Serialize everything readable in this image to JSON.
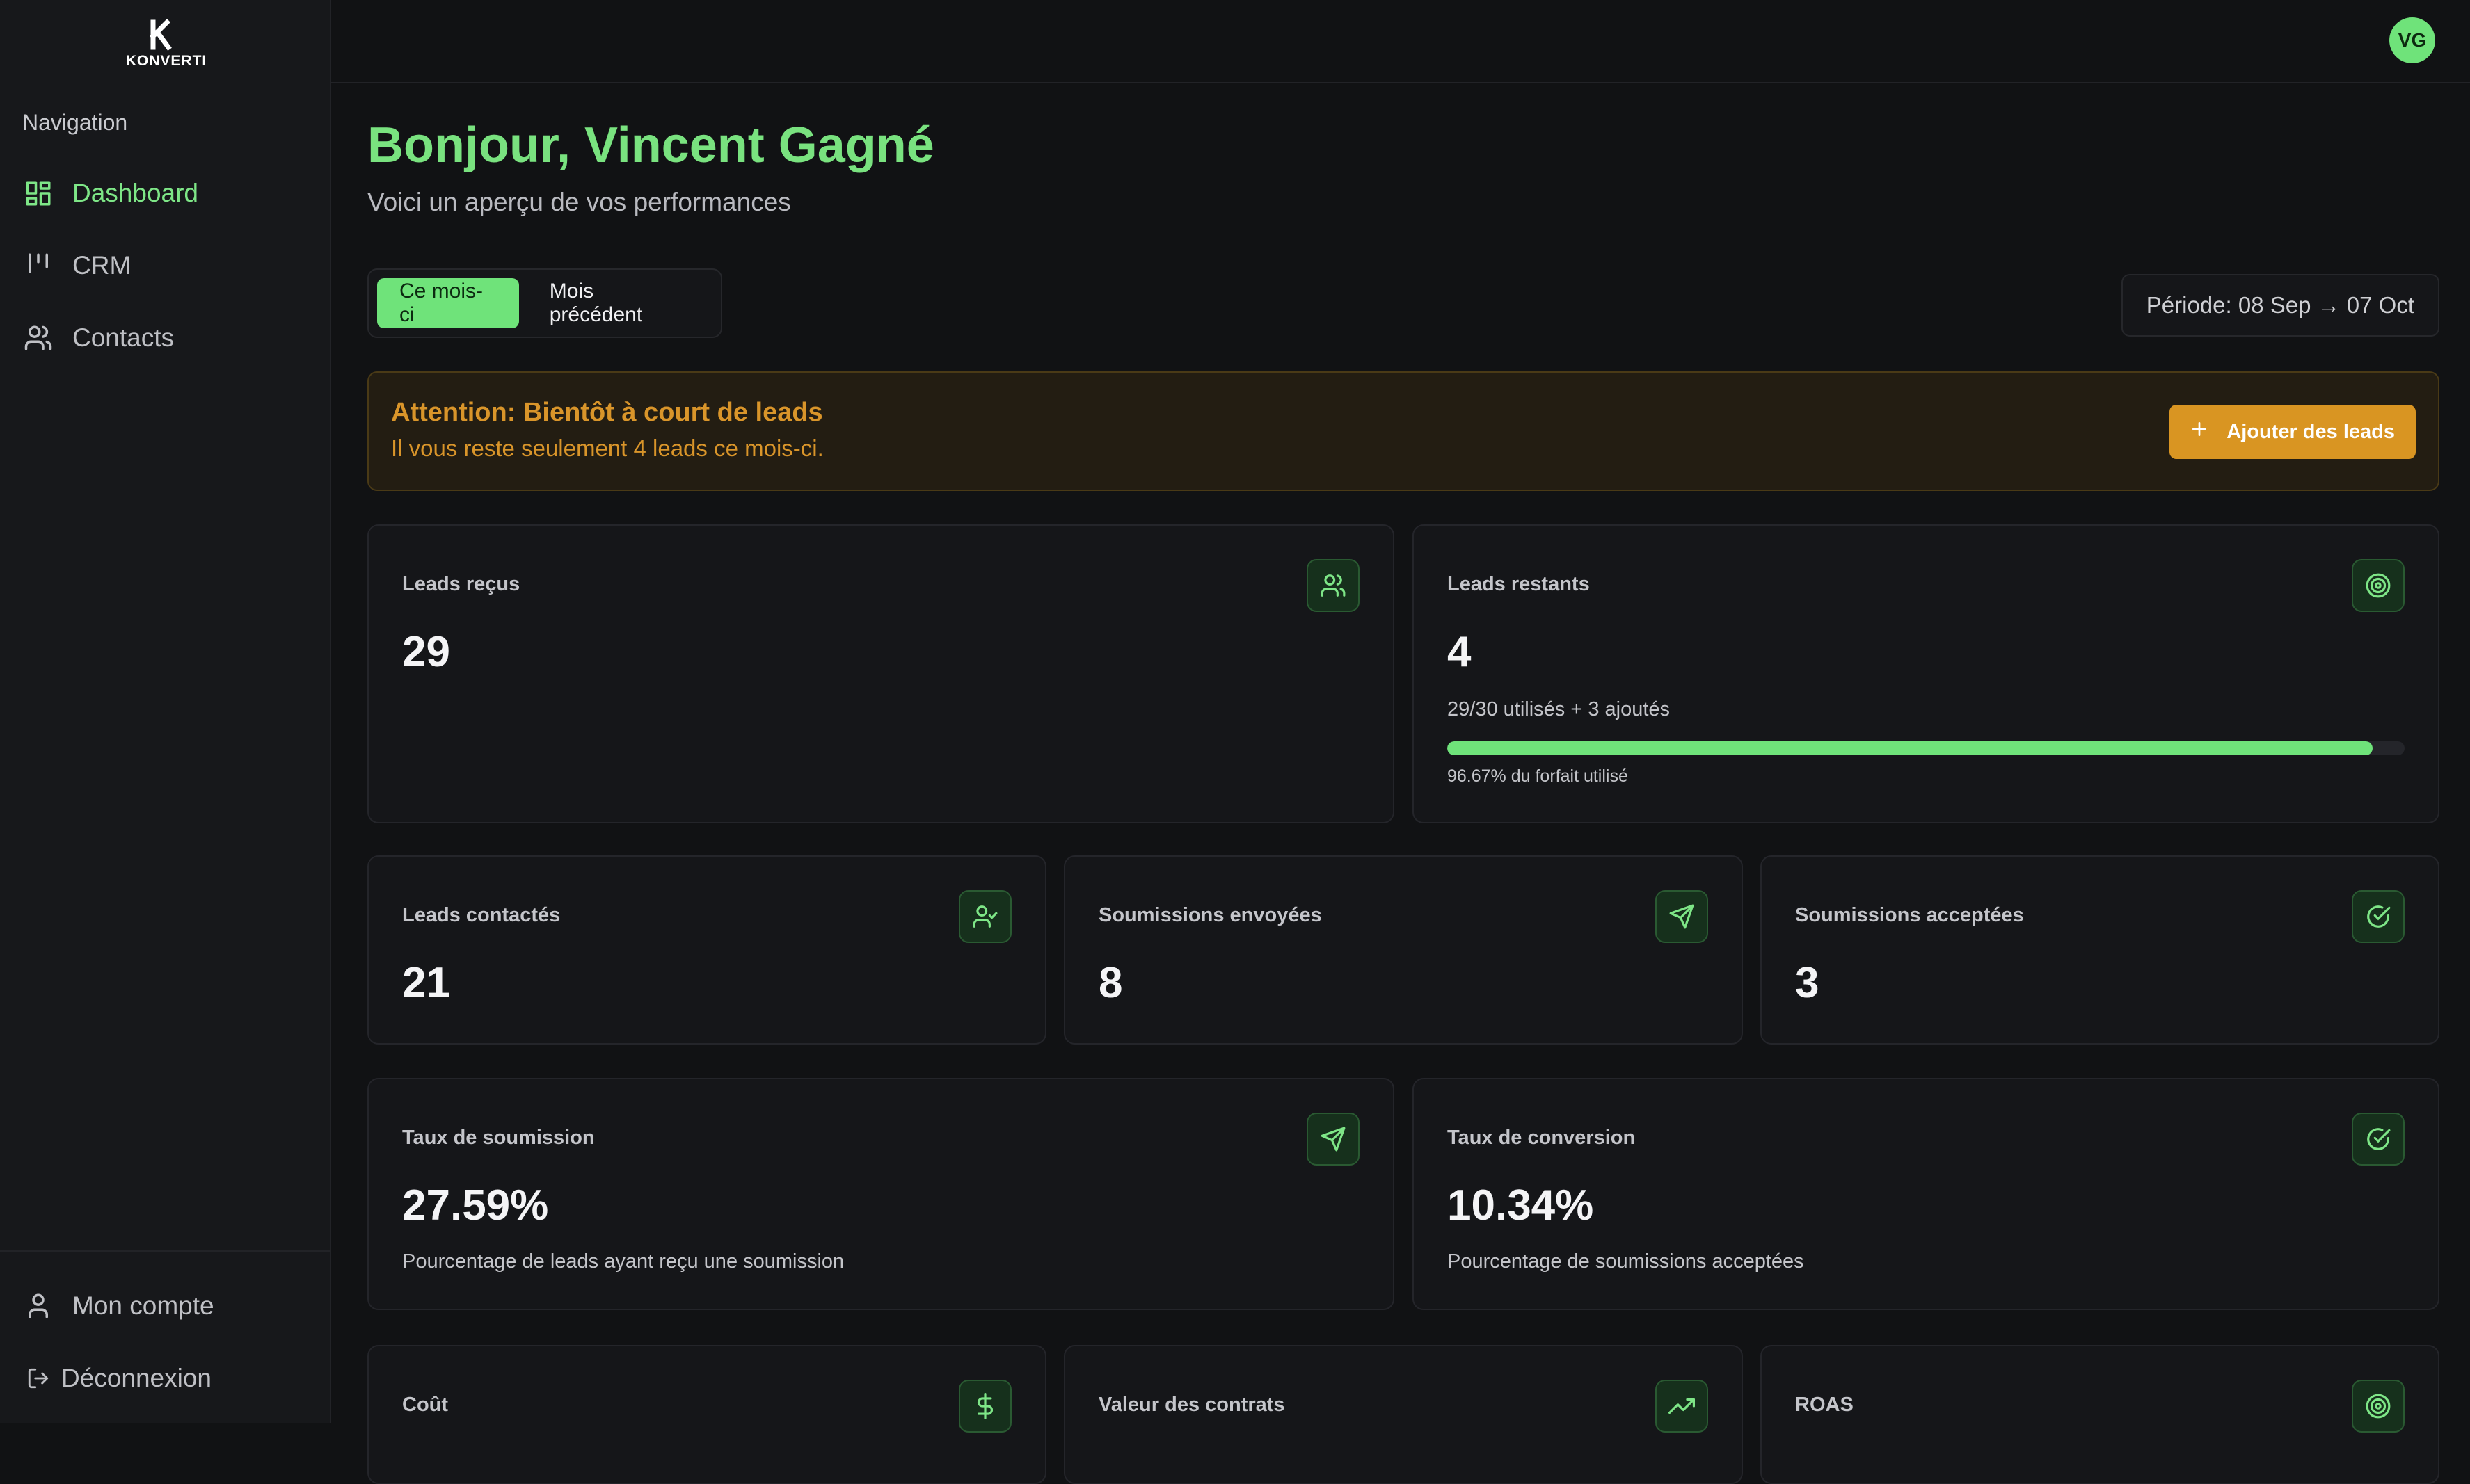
{
  "brand": {
    "name": "KONVERTI"
  },
  "user": {
    "initials": "VG",
    "avatar_color": "#6fe37a"
  },
  "theme": {
    "accent": "#6fe37a",
    "warning": "#d99522",
    "background": "#111214"
  },
  "sidebar": {
    "heading": "Navigation",
    "items": [
      {
        "label": "Dashboard",
        "icon": "dashboard-icon",
        "active": true
      },
      {
        "label": "CRM",
        "icon": "kanban-icon",
        "active": false
      },
      {
        "label": "Contacts",
        "icon": "users-icon",
        "active": false
      }
    ],
    "footer": [
      {
        "label": "Mon compte",
        "icon": "user-icon"
      },
      {
        "label": "Déconnexion",
        "icon": "logout-icon"
      }
    ]
  },
  "header": {
    "greeting": "Bonjour, Vincent Gagné",
    "subtitle": "Voici un aperçu de vos performances"
  },
  "period": {
    "tabs": [
      {
        "label": "Ce mois-ci",
        "active": true
      },
      {
        "label": "Mois précédent",
        "active": false
      }
    ],
    "range": "Période: 08 Sep → 07 Oct"
  },
  "alert": {
    "title": "Attention: Bientôt à court de leads",
    "text": "Il vous reste seulement 4 leads ce mois-ci.",
    "button": "Ajouter des leads"
  },
  "stats": {
    "leads_received": {
      "title": "Leads reçus",
      "value": "29",
      "icon": "users-icon"
    },
    "leads_remaining": {
      "title": "Leads restants",
      "value": "4",
      "icon": "target-icon",
      "usage": "29/30 utilisés + 3 ajoutés",
      "progress_percent": 96.67,
      "progress_caption": "96.67% du forfait utilisé"
    },
    "leads_contacted": {
      "title": "Leads contactés",
      "value": "21",
      "icon": "user-check-icon"
    },
    "quotes_sent": {
      "title": "Soumissions envoyées",
      "value": "8",
      "icon": "send-icon"
    },
    "quotes_accepted": {
      "title": "Soumissions acceptées",
      "value": "3",
      "icon": "check-circle-icon"
    },
    "submission_rate": {
      "title": "Taux de soumission",
      "value": "27.59%",
      "icon": "send-icon",
      "description": "Pourcentage de leads ayant reçu une soumission"
    },
    "conversion_rate": {
      "title": "Taux de conversion",
      "value": "10.34%",
      "icon": "check-circle-icon",
      "description": "Pourcentage de soumissions acceptées"
    },
    "cost": {
      "title": "Coût",
      "icon": "dollar-icon"
    },
    "contract_value": {
      "title": "Valeur des contrats",
      "icon": "trending-up-icon"
    },
    "roas": {
      "title": "ROAS",
      "icon": "target-icon"
    }
  }
}
